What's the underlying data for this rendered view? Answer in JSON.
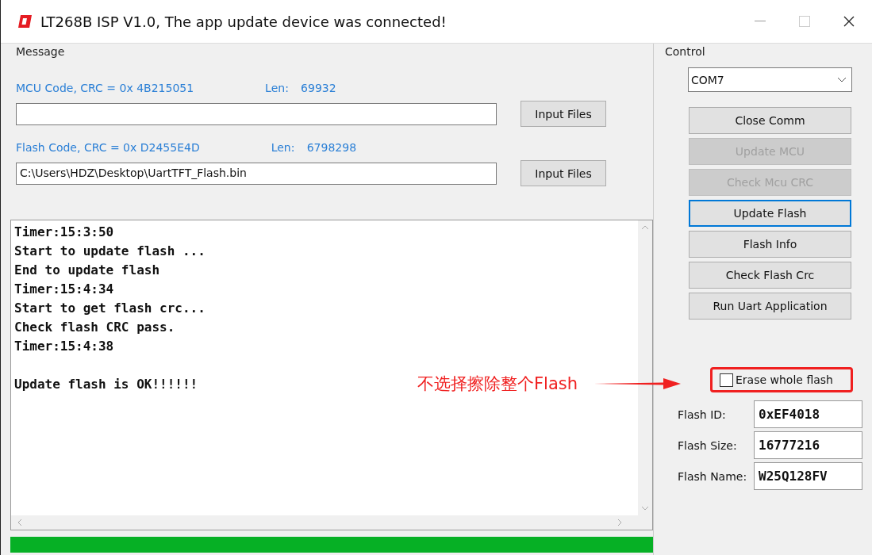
{
  "window": {
    "title": "LT268B ISP V1.0, The app update device was connected!"
  },
  "message": {
    "label": "Message",
    "mcu": {
      "label": "MCU Code, CRC = 0x 4B215051",
      "len_label": "Len:",
      "len": "69932",
      "button": "Input Files"
    },
    "flash": {
      "label": "Flash Code, CRC = 0x D2455E4D",
      "len_label": "Len:",
      "len": "6798298",
      "value": "C:\\Users\\HDZ\\Desktop\\UartTFT_Flash.bin",
      "button": "Input Files"
    }
  },
  "log": [
    {
      "lines": [
        "Timer:15:3:50",
        "Start to update flash ...",
        "End to update flash",
        "Timer:15:4:34",
        "Start to get flash crc...",
        "Check flash CRC pass.",
        "Timer:15:4:38"
      ]
    },
    {
      "lines": [
        "Update flash is OK!!!!!!"
      ]
    }
  ],
  "progress": {
    "level": 1
  },
  "control": {
    "label": "Control",
    "port": "COM7",
    "buttons": [
      {
        "label": "Close Comm",
        "disabled": false,
        "focused": false
      },
      {
        "label": "Update MCU",
        "disabled": true,
        "focused": false
      },
      {
        "label": "Check Mcu CRC",
        "disabled": true,
        "focused": false
      },
      {
        "label": "Update Flash",
        "disabled": false,
        "focused": true
      },
      {
        "label": "Flash Info",
        "disabled": false,
        "focused": false
      },
      {
        "label": "Check Flash Crc",
        "disabled": false,
        "focused": false
      },
      {
        "label": "Run Uart Application",
        "disabled": false,
        "focused": false
      }
    ],
    "erase": {
      "label": "Erase whole flash",
      "checked": false
    },
    "info": [
      {
        "label": "Flash ID:",
        "value": "0xEF4018"
      },
      {
        "label": "Flash Size:",
        "value": "16777216"
      },
      {
        "label": "Flash Name:",
        "value": "W25Q128FV"
      }
    ]
  },
  "annotation": {
    "text": "不选择擦除整个Flash"
  }
}
